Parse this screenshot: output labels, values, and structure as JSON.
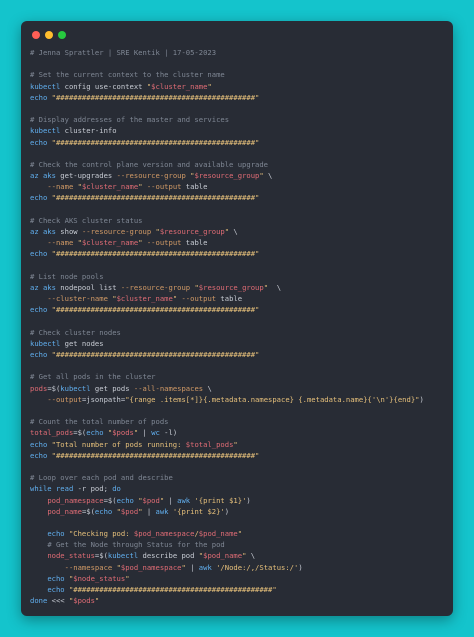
{
  "window": {
    "controls": [
      {
        "name": "close",
        "color": "#ff5f56"
      },
      {
        "name": "minimize",
        "color": "#ffbd2e"
      },
      {
        "name": "maximize",
        "color": "#27c93f"
      }
    ]
  },
  "code_lines": [
    [
      [
        "c",
        "# Jenna Sprattler | SRE Kentik | 17-05-2023"
      ]
    ],
    [],
    [
      [
        "c",
        "# Set the current context to the cluster name"
      ]
    ],
    [
      [
        "k",
        "kubectl"
      ],
      [
        "t",
        " config use-context "
      ],
      [
        "s",
        "\""
      ],
      [
        "v",
        "$cluster_name"
      ],
      [
        "s",
        "\""
      ]
    ],
    [
      [
        "k",
        "echo"
      ],
      [
        "t",
        " "
      ],
      [
        "s",
        "\"##############################################\""
      ]
    ],
    [],
    [
      [
        "c",
        "# Display addresses of the master and services"
      ]
    ],
    [
      [
        "k",
        "kubectl"
      ],
      [
        "t",
        " cluster-info"
      ]
    ],
    [
      [
        "k",
        "echo"
      ],
      [
        "t",
        " "
      ],
      [
        "s",
        "\"##############################################\""
      ]
    ],
    [],
    [
      [
        "c",
        "# Check the control plane version and available upgrade"
      ]
    ],
    [
      [
        "k",
        "az aks"
      ],
      [
        "t",
        " get-upgrades "
      ],
      [
        "f",
        "--resource-group"
      ],
      [
        "t",
        " "
      ],
      [
        "s",
        "\""
      ],
      [
        "v",
        "$resource_group"
      ],
      [
        "s",
        "\""
      ],
      [
        "t",
        " \\"
      ]
    ],
    [
      [
        "t",
        "    "
      ],
      [
        "f",
        "--name"
      ],
      [
        "t",
        " "
      ],
      [
        "s",
        "\""
      ],
      [
        "v",
        "$cluster_name"
      ],
      [
        "s",
        "\""
      ],
      [
        "t",
        " "
      ],
      [
        "f",
        "--output"
      ],
      [
        "t",
        " table"
      ]
    ],
    [
      [
        "k",
        "echo"
      ],
      [
        "t",
        " "
      ],
      [
        "s",
        "\"##############################################\""
      ]
    ],
    [],
    [
      [
        "c",
        "# Check AKS cluster status"
      ]
    ],
    [
      [
        "k",
        "az aks"
      ],
      [
        "t",
        " show "
      ],
      [
        "f",
        "--resource-group"
      ],
      [
        "t",
        " "
      ],
      [
        "s",
        "\""
      ],
      [
        "v",
        "$resource_group"
      ],
      [
        "s",
        "\""
      ],
      [
        "t",
        " \\"
      ]
    ],
    [
      [
        "t",
        "    "
      ],
      [
        "f",
        "--name"
      ],
      [
        "t",
        " "
      ],
      [
        "s",
        "\""
      ],
      [
        "v",
        "$cluster_name"
      ],
      [
        "s",
        "\""
      ],
      [
        "t",
        " "
      ],
      [
        "f",
        "--output"
      ],
      [
        "t",
        " table"
      ]
    ],
    [
      [
        "k",
        "echo"
      ],
      [
        "t",
        " "
      ],
      [
        "s",
        "\"##############################################\""
      ]
    ],
    [],
    [
      [
        "c",
        "# List node pools"
      ]
    ],
    [
      [
        "k",
        "az aks"
      ],
      [
        "t",
        " nodepool list "
      ],
      [
        "f",
        "--resource-group"
      ],
      [
        "t",
        " "
      ],
      [
        "s",
        "\""
      ],
      [
        "v",
        "$resource_group"
      ],
      [
        "s",
        "\""
      ],
      [
        "t",
        "  \\"
      ]
    ],
    [
      [
        "t",
        "    "
      ],
      [
        "f",
        "--cluster-name"
      ],
      [
        "t",
        " "
      ],
      [
        "s",
        "\""
      ],
      [
        "v",
        "$cluster_name"
      ],
      [
        "s",
        "\""
      ],
      [
        "t",
        " "
      ],
      [
        "f",
        "--output"
      ],
      [
        "t",
        " table"
      ]
    ],
    [
      [
        "k",
        "echo"
      ],
      [
        "t",
        " "
      ],
      [
        "s",
        "\"##############################################\""
      ]
    ],
    [],
    [
      [
        "c",
        "# Check cluster nodes"
      ]
    ],
    [
      [
        "k",
        "kubectl"
      ],
      [
        "t",
        " get nodes"
      ]
    ],
    [
      [
        "k",
        "echo"
      ],
      [
        "t",
        " "
      ],
      [
        "s",
        "\"##############################################\""
      ]
    ],
    [],
    [
      [
        "c",
        "# Get all pods in the cluster"
      ]
    ],
    [
      [
        "v",
        "pods"
      ],
      [
        "t",
        "=$("
      ],
      [
        "k",
        "kubectl"
      ],
      [
        "t",
        " get pods "
      ],
      [
        "f",
        "--all-namespaces"
      ],
      [
        "t",
        " \\"
      ]
    ],
    [
      [
        "t",
        "    "
      ],
      [
        "f",
        "--output"
      ],
      [
        "t",
        "=jsonpath="
      ],
      [
        "s",
        "\"{range .items[*]}{.metadata.namespace} {.metadata.name}{'\\n'}{end}\""
      ],
      [
        "t",
        ")"
      ]
    ],
    [],
    [
      [
        "c",
        "# Count the total number of pods"
      ]
    ],
    [
      [
        "v",
        "total_pods"
      ],
      [
        "t",
        "=$("
      ],
      [
        "k",
        "echo"
      ],
      [
        "t",
        " "
      ],
      [
        "s",
        "\""
      ],
      [
        "v",
        "$pods"
      ],
      [
        "s",
        "\""
      ],
      [
        "t",
        " | "
      ],
      [
        "k",
        "wc"
      ],
      [
        "t",
        " -l)"
      ]
    ],
    [
      [
        "k",
        "echo"
      ],
      [
        "t",
        " "
      ],
      [
        "s",
        "\"Total number of pods running: "
      ],
      [
        "v",
        "$total_pods"
      ],
      [
        "s",
        "\""
      ]
    ],
    [
      [
        "k",
        "echo"
      ],
      [
        "t",
        " "
      ],
      [
        "s",
        "\"##############################################\""
      ]
    ],
    [],
    [
      [
        "c",
        "# Loop over each pod and describe"
      ]
    ],
    [
      [
        "k",
        "while read"
      ],
      [
        "t",
        " -r pod; "
      ],
      [
        "k",
        "do"
      ]
    ],
    [
      [
        "t",
        "    "
      ],
      [
        "v",
        "pod_namespace"
      ],
      [
        "t",
        "=$("
      ],
      [
        "k",
        "echo"
      ],
      [
        "t",
        " "
      ],
      [
        "s",
        "\""
      ],
      [
        "v",
        "$pod"
      ],
      [
        "s",
        "\""
      ],
      [
        "t",
        " | "
      ],
      [
        "k",
        "awk"
      ],
      [
        "t",
        " "
      ],
      [
        "s",
        "'{print $1}'"
      ],
      [
        "t",
        ")"
      ]
    ],
    [
      [
        "t",
        "    "
      ],
      [
        "v",
        "pod_name"
      ],
      [
        "t",
        "=$("
      ],
      [
        "k",
        "echo"
      ],
      [
        "t",
        " "
      ],
      [
        "s",
        "\""
      ],
      [
        "v",
        "$pod"
      ],
      [
        "s",
        "\""
      ],
      [
        "t",
        " | "
      ],
      [
        "k",
        "awk"
      ],
      [
        "t",
        " "
      ],
      [
        "s",
        "'{print $2}'"
      ],
      [
        "t",
        ")"
      ]
    ],
    [],
    [
      [
        "t",
        "    "
      ],
      [
        "k",
        "echo"
      ],
      [
        "t",
        " "
      ],
      [
        "s",
        "\"Checking pod: "
      ],
      [
        "v",
        "$pod_namespace"
      ],
      [
        "s",
        "/"
      ],
      [
        "v",
        "$pod_name"
      ],
      [
        "s",
        "\""
      ]
    ],
    [
      [
        "t",
        "    "
      ],
      [
        "c",
        "# Get the Node through Status for the pod"
      ]
    ],
    [
      [
        "t",
        "    "
      ],
      [
        "v",
        "node_status"
      ],
      [
        "t",
        "=$("
      ],
      [
        "k",
        "kubectl"
      ],
      [
        "t",
        " describe pod "
      ],
      [
        "s",
        "\""
      ],
      [
        "v",
        "$pod_name"
      ],
      [
        "s",
        "\""
      ],
      [
        "t",
        " \\"
      ]
    ],
    [
      [
        "t",
        "        "
      ],
      [
        "f",
        "--namespace"
      ],
      [
        "t",
        " "
      ],
      [
        "s",
        "\""
      ],
      [
        "v",
        "$pod_namespace"
      ],
      [
        "s",
        "\""
      ],
      [
        "t",
        " | "
      ],
      [
        "k",
        "awk"
      ],
      [
        "t",
        " "
      ],
      [
        "s",
        "'/Node:/,/Status:/'"
      ],
      [
        "t",
        ")"
      ]
    ],
    [
      [
        "t",
        "    "
      ],
      [
        "k",
        "echo"
      ],
      [
        "t",
        " "
      ],
      [
        "s",
        "\""
      ],
      [
        "v",
        "$node_status"
      ],
      [
        "s",
        "\""
      ]
    ],
    [
      [
        "t",
        "    "
      ],
      [
        "k",
        "echo"
      ],
      [
        "t",
        " "
      ],
      [
        "s",
        "\"##############################################\""
      ]
    ],
    [
      [
        "k",
        "done"
      ],
      [
        "t",
        " <<< "
      ],
      [
        "s",
        "\""
      ],
      [
        "v",
        "$pods"
      ],
      [
        "s",
        "\""
      ]
    ]
  ]
}
